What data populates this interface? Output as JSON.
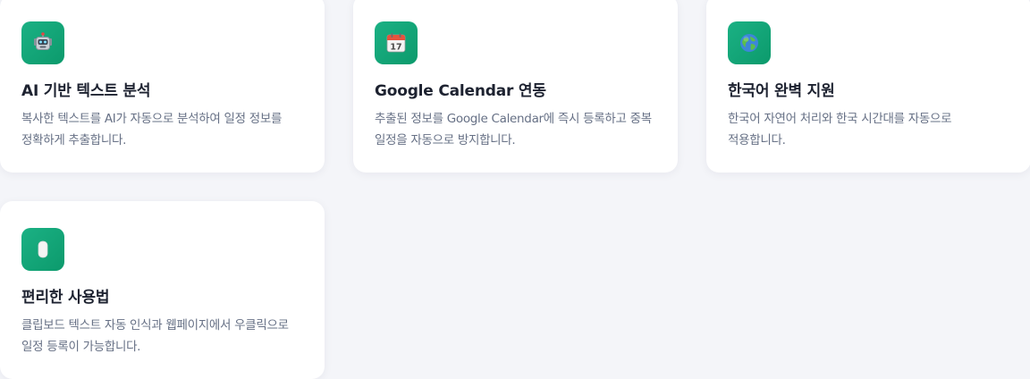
{
  "features": [
    {
      "icon": "robot-icon",
      "title": "AI 기반 텍스트 분석",
      "description": "복사한 텍스트를 AI가 자동으로 분석하여 일정 정보를 정확하게 추출합니다."
    },
    {
      "icon": "calendar-icon",
      "icon_text": "17",
      "title": "Google Calendar 연동",
      "description": "추출된 정보를 Google Calendar에 즉시 등록하고 중복 일정을 자동으로 방지합니다."
    },
    {
      "icon": "globe-icon",
      "title": "한국어 완벽 지원",
      "description": "한국어 자연어 처리와 한국 시간대를 자동으로 적용합니다."
    },
    {
      "icon": "mouse-icon",
      "title": "편리한 사용법",
      "description": "클립보드 텍스트 자동 인식과 웹페이지에서 우클릭으로 일정 등록이 가능합니다."
    }
  ]
}
